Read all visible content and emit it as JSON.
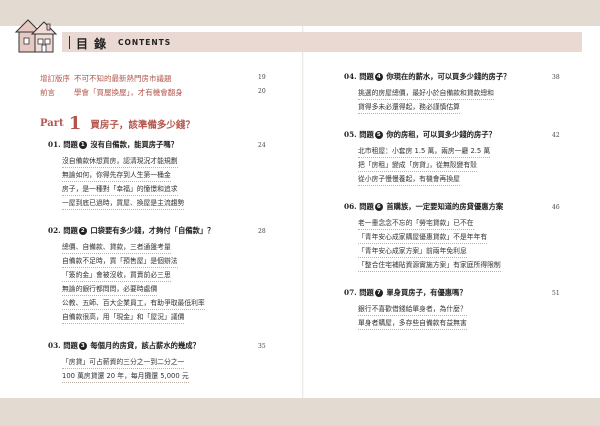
{
  "header": {
    "title": "目 錄",
    "subtitle": "CONTENTS"
  },
  "intro": [
    {
      "label": "增訂版序",
      "text": "不可不知的最新熱門房市議題",
      "page": "19"
    },
    {
      "label": "前言",
      "text": "學會「買屋換屋」，才有機會翻身",
      "page": "20"
    }
  ],
  "part": {
    "word": "Part",
    "number": "1",
    "title": "買房子，該準備多少錢？"
  },
  "left_entries": [
    {
      "num": "01.",
      "q": "問題",
      "n": "1",
      "title": "沒有自備款，能買房子嗎？",
      "page": "24",
      "lines": [
        "沒自備款休想買房，認清現況才能規劃",
        "無論如何，你得先存到人生第一桶金",
        "房子，是一種對「幸福」的憧憬和追求",
        "一屋到底已過時，買屋、換屋是主流趨勢"
      ]
    },
    {
      "num": "02.",
      "q": "問題",
      "n": "2",
      "title": "口袋要有多少錢，才夠付「自備款」？",
      "page": "28",
      "lines": [
        "總價、自備款、貸款，三者通盤考量",
        "自備款不足時，買「預售屋」是個辦法",
        "「簽約金」會被沒收，買賣前必三思",
        "無論的銀行都問問，必要時處價",
        "公教、五師、百大企業員工，有助爭取最低利率",
        "自備款很高，用「現金」和「屋況」議價"
      ]
    },
    {
      "num": "03.",
      "q": "問題",
      "n": "3",
      "title": "每個月的房貸，該占薪水的幾成？",
      "page": "35",
      "lines": [
        "「房貸」可占薪資的三分之一到二分之一",
        "100 萬房貸還 20 年，每月攤還 5,000 元"
      ]
    }
  ],
  "right_entries": [
    {
      "num": "04.",
      "q": "問題",
      "n": "4",
      "title": "你現在的薪水，可以買多少錢的房子？",
      "page": "38",
      "lines": [
        "挑選的房屋總價，最好小於自備款和貸款總和",
        "貸得多未必還得起，務必謹慎估算"
      ]
    },
    {
      "num": "05.",
      "q": "問題",
      "n": "5",
      "title": "你的房租，可以買多少錢的房子？",
      "page": "42",
      "lines": [
        "北市租屋：小套房 1.5 萬，兩房一廳 2.5 萬",
        "把「房租」變成「房貸」，從無殼變有殼",
        "從小房子慢慢養起，有機會再換屋"
      ]
    },
    {
      "num": "06.",
      "q": "問題",
      "n": "6",
      "title": "首購族，一定要知道的房貸優惠方案",
      "page": "46",
      "lines": [
        "老一輩念念不忘的「勞宅貸款」已不在",
        "「青年安心成家購屋優惠貸款」不是年年有",
        "「青年安心成家方案」前兩年免利息",
        "「整合住宅補貼資源實施方案」有家庭所得限制"
      ]
    },
    {
      "num": "07.",
      "q": "問題",
      "n": "7",
      "title": "單身買房子，有優惠嗎？",
      "page": "51",
      "lines": [
        "銀行不喜歡借錢給單身者，為什麼？",
        "單身者購屋，多存些自備款有益無害"
      ]
    }
  ],
  "colors": {
    "accent": "#b5564d",
    "band": "#e3dad2",
    "toc_bar": "#ead9d3"
  },
  "icons": [
    "house-logo-icon"
  ]
}
